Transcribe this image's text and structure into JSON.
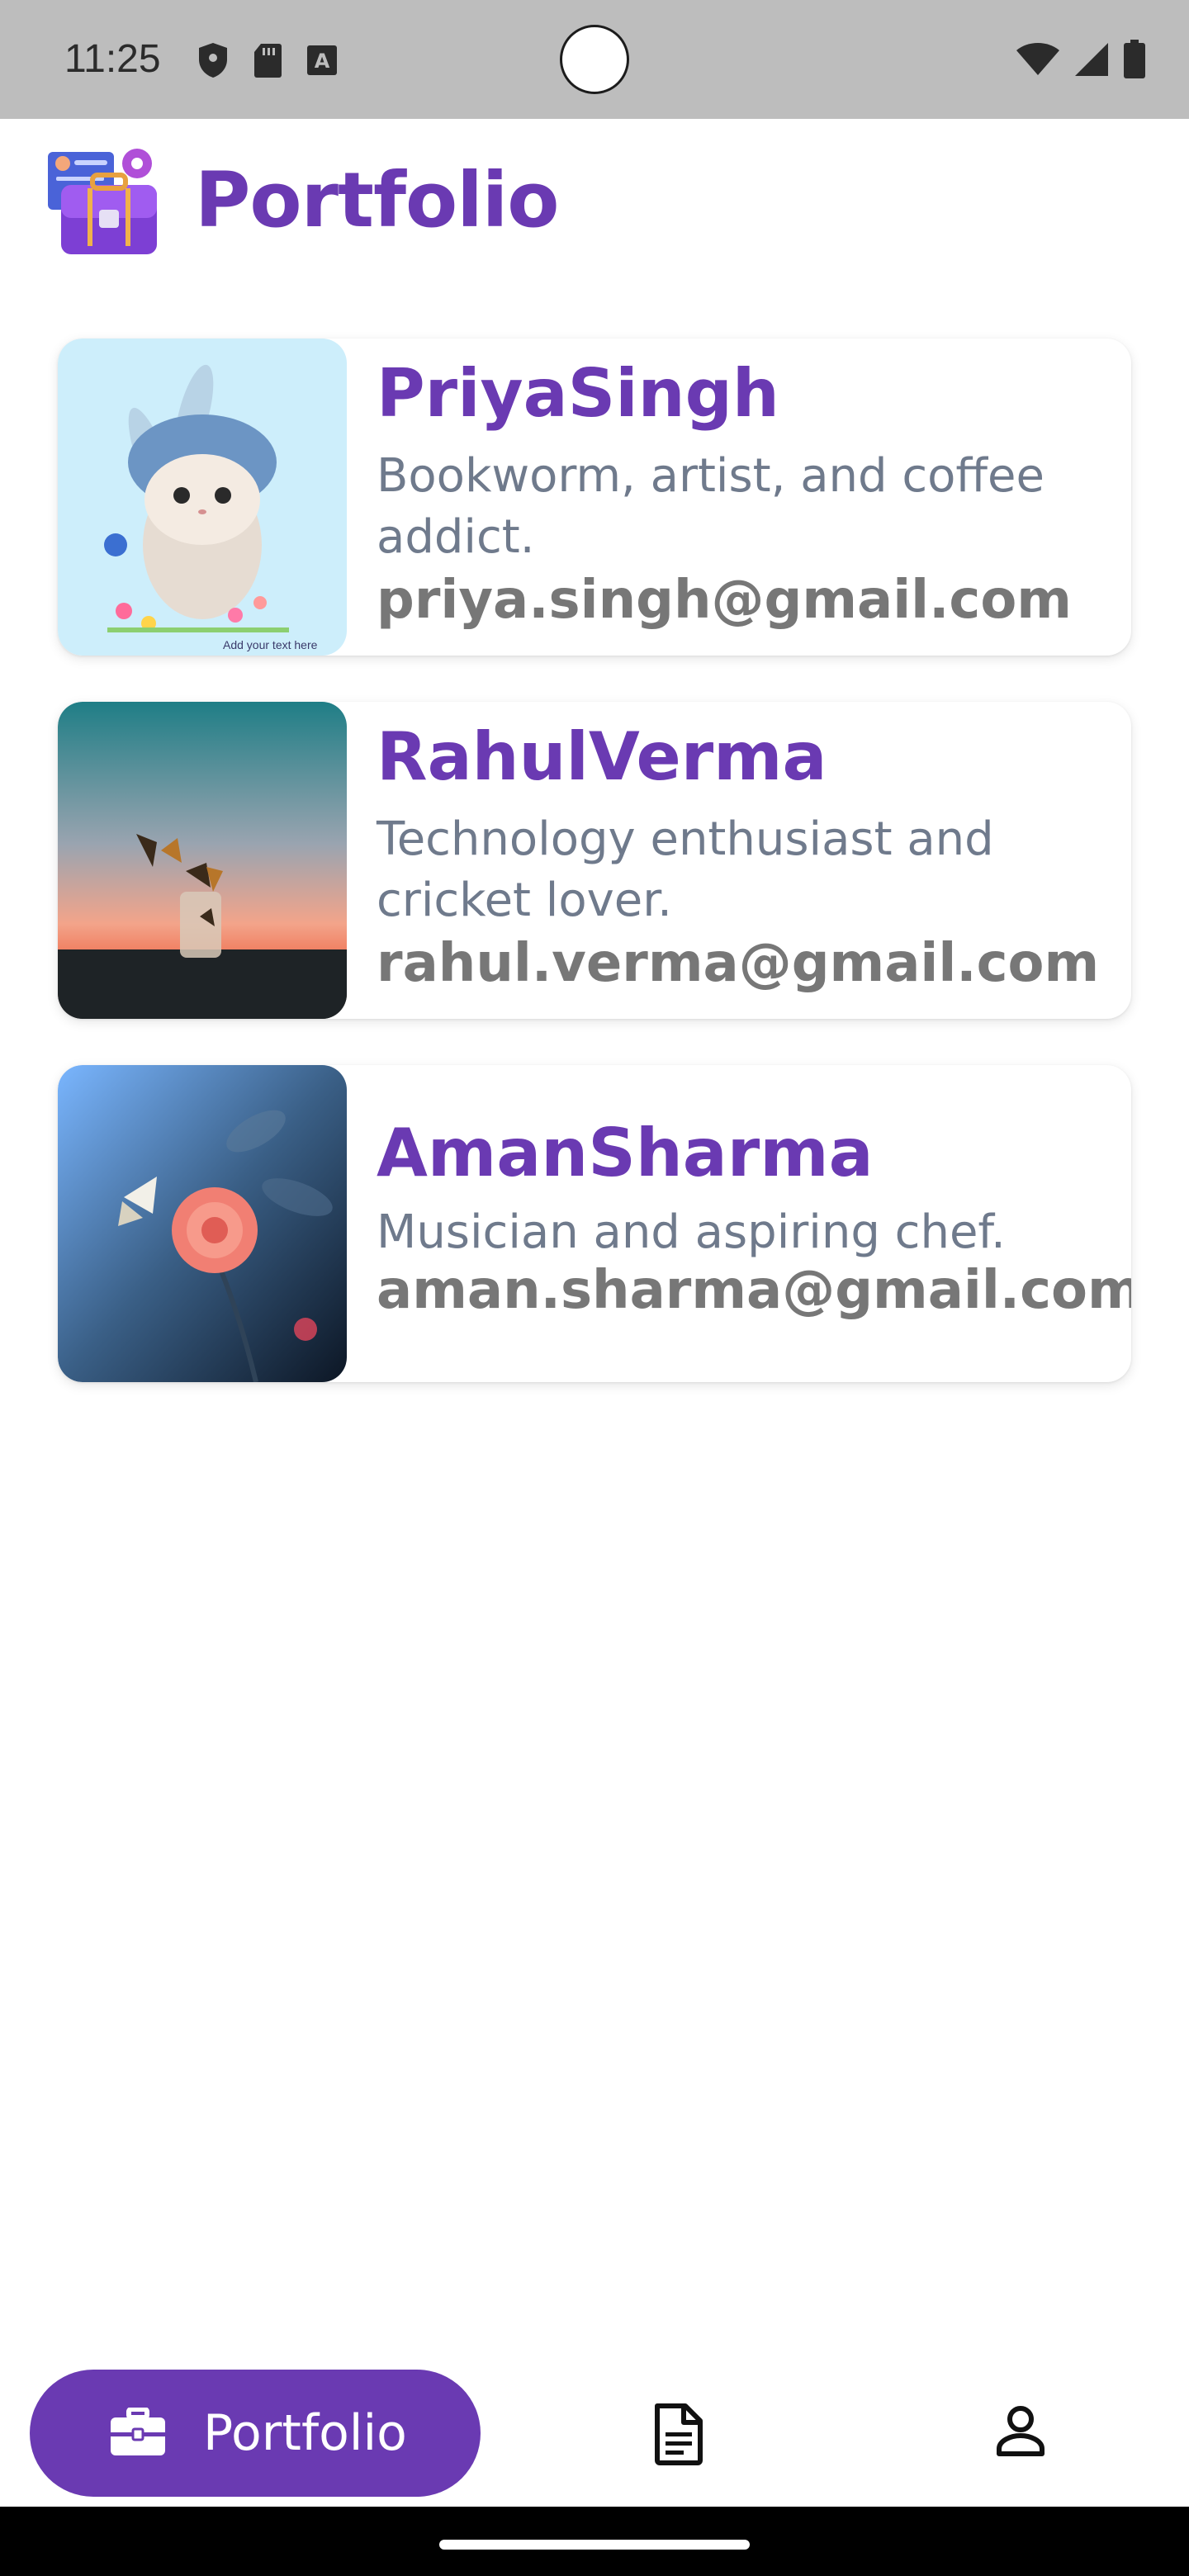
{
  "status_bar": {
    "time": "11:25",
    "icons_left": [
      "shield-icon",
      "sd-card-icon",
      "font-a-icon"
    ],
    "icons_right": [
      "wifi-icon",
      "cellular-signal-icon",
      "battery-icon"
    ]
  },
  "header": {
    "title": "Portfolio",
    "logo_icon": "portfolio-briefcase-logo"
  },
  "profiles": [
    {
      "name": " PriyaSingh",
      "bio": "Bookworm, artist, and coffee addict.",
      "email": "priya.singh@gmail.com",
      "image": "bunny-illustration",
      "image_caption": "Add your text here"
    },
    {
      "name": "RahulVerma",
      "bio": "Technology enthusiast and cricket lover.",
      "email": "rahul.verma@gmail.com",
      "image": "butterflies-jar-sunset"
    },
    {
      "name": "AmanSharma",
      "bio": " Musician and aspiring chef.",
      "email": "aman.sharma@gmail.com",
      "image": "butterfly-rose"
    }
  ],
  "bottom_nav": {
    "items": [
      {
        "label": "Portfolio",
        "icon": "briefcase-icon",
        "active": true
      },
      {
        "label": "",
        "icon": "document-icon",
        "active": false
      },
      {
        "label": "",
        "icon": "person-icon",
        "active": false
      }
    ]
  },
  "colors": {
    "accent": "#6a3ab2",
    "status_bar": "#bdbdbd",
    "bio_text": "#6f7a8c",
    "email_text": "#777777"
  }
}
